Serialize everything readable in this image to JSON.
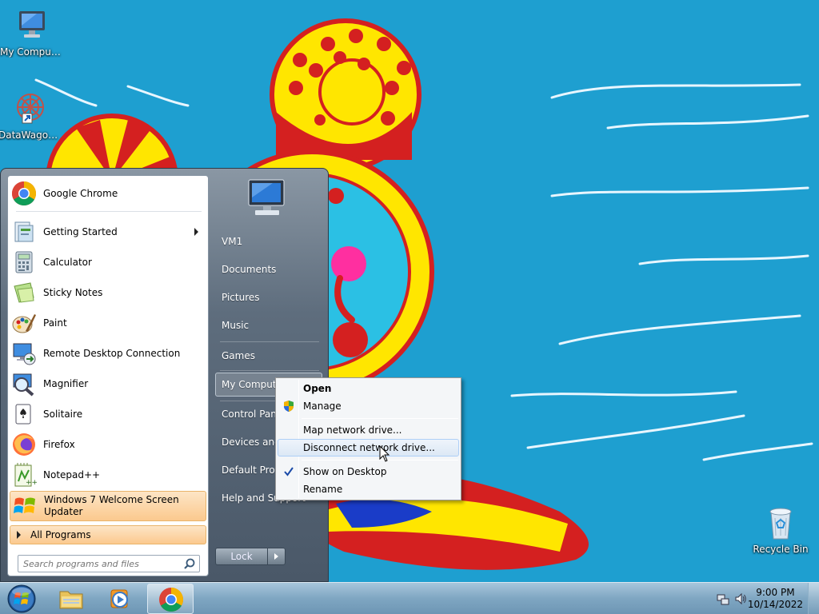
{
  "desktop": {
    "icons": [
      {
        "label": "My Computer",
        "icon": "computer-icon"
      },
      {
        "label": "DataWagon...",
        "icon": "datawagon-shortcut-icon"
      },
      {
        "label": "Recycle Bin",
        "icon": "recycle-bin-icon"
      }
    ]
  },
  "start_menu": {
    "programs": [
      {
        "label": "Google Chrome",
        "icon": "chrome-icon"
      },
      {
        "label": "Getting Started",
        "icon": "getting-started-icon",
        "has_submenu": true
      },
      {
        "label": "Calculator",
        "icon": "calculator-icon"
      },
      {
        "label": "Sticky Notes",
        "icon": "sticky-notes-icon"
      },
      {
        "label": "Paint",
        "icon": "paint-icon"
      },
      {
        "label": "Remote Desktop Connection",
        "icon": "remote-desktop-icon"
      },
      {
        "label": "Magnifier",
        "icon": "magnifier-icon"
      },
      {
        "label": "Solitaire",
        "icon": "solitaire-icon"
      },
      {
        "label": "Firefox",
        "icon": "firefox-icon"
      },
      {
        "label": "Notepad++",
        "icon": "notepadpp-icon"
      },
      {
        "label": "Windows 7 Welcome Screen Updater",
        "icon": "windows-logo-icon"
      }
    ],
    "all_programs": "All Programs",
    "search_placeholder": "Search programs and files",
    "right_items": [
      {
        "label": "VM1"
      },
      {
        "label": "Documents"
      },
      {
        "label": "Pictures"
      },
      {
        "label": "Music"
      },
      {
        "label": "Games"
      },
      {
        "label": "My Computer"
      },
      {
        "label": "Control Panel"
      },
      {
        "label": "Devices and Printers"
      },
      {
        "label": "Default Programs"
      },
      {
        "label": "Help and Support"
      }
    ],
    "lock_label": "Lock"
  },
  "context_menu": {
    "items": [
      {
        "label": "Open",
        "bold": true
      },
      {
        "label": "Manage",
        "icon": "uac-shield-icon"
      },
      {
        "label": "Map network drive..."
      },
      {
        "label": "Disconnect network drive..."
      },
      {
        "label": "Show on Desktop",
        "checked": true
      },
      {
        "label": "Rename"
      }
    ]
  },
  "taskbar": {
    "pinned": [
      {
        "icon": "explorer-folder-icon"
      },
      {
        "icon": "media-player-icon"
      },
      {
        "icon": "chrome-icon",
        "active": true
      }
    ],
    "clock_time": "9:00 PM",
    "clock_date": "10/14/2022"
  },
  "colors": {
    "wallpaper": "#1e9fd0",
    "hover_highlight": "#fbc98e",
    "accent_red": "#d42020",
    "accent_yellow": "#ffe600"
  }
}
